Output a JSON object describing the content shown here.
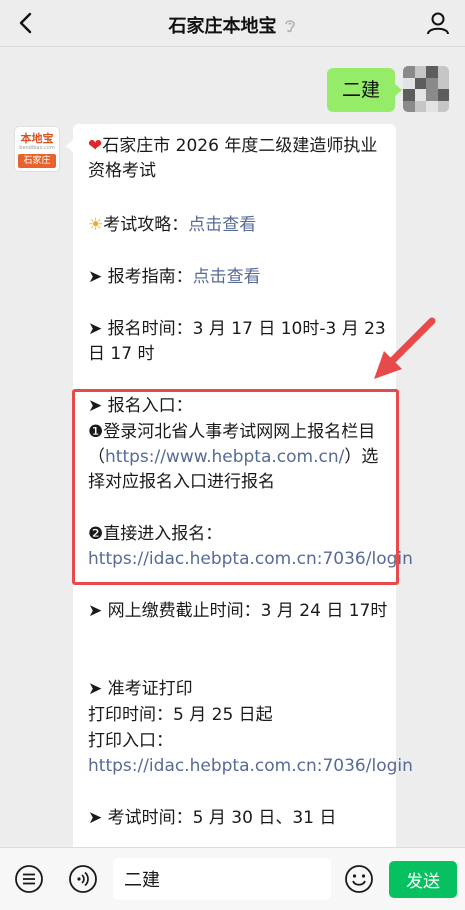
{
  "header": {
    "title": "石家庄本地宝",
    "back_icon": "chevron-left-icon",
    "profile_icon": "person-icon",
    "ear_icon": "earpiece-icon"
  },
  "chat": {
    "user_message": "二建",
    "bot_avatar": {
      "brand": "本地宝",
      "url": "bendibao.com",
      "city": "石家庄"
    },
    "bot_message": {
      "heading": "石家庄市 2026 年度二级建造师执业资格考试",
      "strategy_label": "考试攻略：",
      "strategy_link": "点击查看",
      "guide_label": "报考指南：",
      "guide_link": "点击查看",
      "reg_time_label": "报名时间：",
      "reg_time_value": "3 月 17 日 10时-3 月 23 日 17 时",
      "reg_entry_label": "报名入口：",
      "entry1_text_a": "登录河北省人事考试网网上报名栏目（",
      "entry1_link": "https://www.hebpta.com.cn/",
      "entry1_text_b": "）选择对应报名入口进行报名",
      "entry2_label": "直接进入报名：",
      "entry2_link": "https://idac.hebpta.com.cn:7036/login",
      "fee_deadline_label": "网上缴费截止时间：",
      "fee_deadline_value": "3 月 24 日 17时",
      "admit_title": "准考证打印",
      "print_time_label": "打印时间：",
      "print_time_value": "5 月 25 日起",
      "print_entry_label": "打印入口：",
      "print_entry_link": "https://idac.hebpta.com.cn:7036/login",
      "exam_time_label": "考试时间：",
      "exam_time_value": "5 月 30 日、31 日"
    }
  },
  "input_bar": {
    "menu_icon": "menu-list-icon",
    "voice_icon": "voice-icon",
    "input_value": "二建",
    "emoji_icon": "emoji-icon",
    "send_label": "发送"
  },
  "colors": {
    "send": "#07c160",
    "user_bubble": "#95ec69",
    "link": "#576b95",
    "highlight": "#e64a4a"
  }
}
